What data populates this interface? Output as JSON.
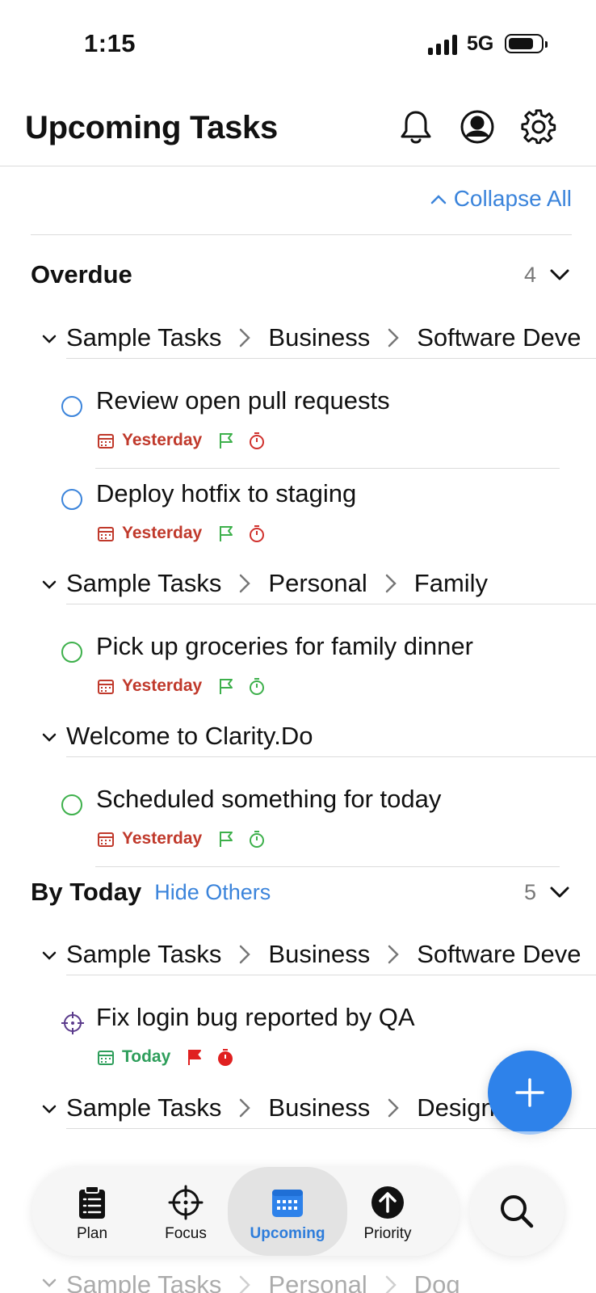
{
  "status_bar": {
    "time": "1:15",
    "network": "5G"
  },
  "header": {
    "title": "Upcoming Tasks"
  },
  "collapse_label": "Collapse All",
  "colors": {
    "accent": "#3b84db",
    "overdue_red": "#c0392b",
    "today_green": "#2e9e5b",
    "flag_green": "#3db04b",
    "fab_blue": "#2e82ea"
  },
  "sections": [
    {
      "title": "Overdue",
      "count": "4",
      "groups": [
        {
          "path": [
            "Sample Tasks",
            "Business",
            "Software Deve"
          ],
          "tasks": [
            {
              "title": "Review open pull requests",
              "date": "Yesterday",
              "circle": "blue-circle",
              "timer": "red"
            },
            {
              "title": "Deploy hotfix to staging",
              "date": "Yesterday",
              "circle": "blue-circle",
              "timer": "red"
            }
          ]
        },
        {
          "path": [
            "Sample Tasks",
            "Personal",
            "Family"
          ],
          "tasks": [
            {
              "title": "Pick up groceries for family dinner",
              "date": "Yesterday",
              "circle": "green-circle",
              "timer": "green"
            }
          ]
        },
        {
          "path": [
            "Welcome to Clarity.Do"
          ],
          "tasks": [
            {
              "title": "Scheduled something for today",
              "date": "Yesterday",
              "circle": "green-circle",
              "timer": "green"
            }
          ]
        }
      ]
    },
    {
      "title": "By Today",
      "action": "Hide Others",
      "count": "5",
      "groups": [
        {
          "path": [
            "Sample Tasks",
            "Business",
            "Software Deve"
          ],
          "tasks": [
            {
              "title": "Fix login bug reported by QA",
              "date": "Today",
              "circle": "target-icon",
              "timer": "red-filled"
            }
          ]
        },
        {
          "path": [
            "Sample Tasks",
            "Business",
            "Designer"
          ],
          "tasks": []
        },
        {
          "path": [
            "Sample Tasks",
            "Personal",
            "Dog"
          ],
          "tasks": []
        }
      ]
    }
  ],
  "tabs": [
    {
      "label": "Plan",
      "icon": "clipboard-list-icon"
    },
    {
      "label": "Focus",
      "icon": "crosshair-icon"
    },
    {
      "label": "Upcoming",
      "icon": "calendar-icon",
      "active": true
    },
    {
      "label": "Priority",
      "icon": "arrow-up-circle-icon"
    }
  ],
  "search_icon": "search-icon",
  "add_icon": "plus-icon"
}
